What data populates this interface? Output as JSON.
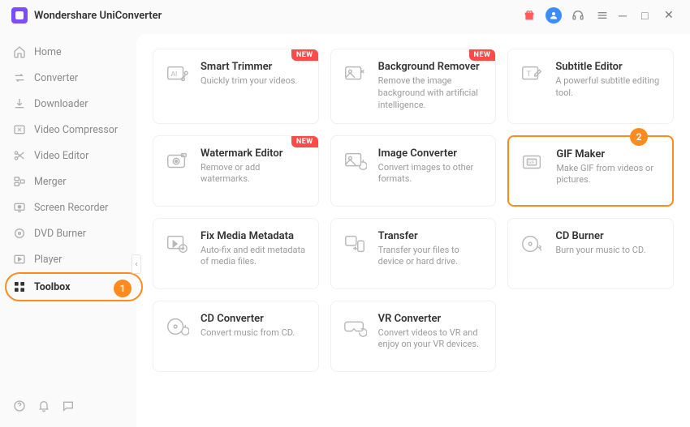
{
  "app": {
    "title": "Wondershare UniConverter"
  },
  "sidebar": {
    "items": [
      {
        "label": "Home"
      },
      {
        "label": "Converter"
      },
      {
        "label": "Downloader"
      },
      {
        "label": "Video Compressor"
      },
      {
        "label": "Video Editor"
      },
      {
        "label": "Merger"
      },
      {
        "label": "Screen Recorder"
      },
      {
        "label": "DVD Burner"
      },
      {
        "label": "Player"
      },
      {
        "label": "Toolbox"
      }
    ]
  },
  "annotations": {
    "one": "1",
    "two": "2"
  },
  "new_label": "NEW",
  "tools": [
    {
      "title": "Smart Trimmer",
      "desc": "Quickly trim your videos.",
      "new": true
    },
    {
      "title": "Background Remover",
      "desc": "Remove the image background with artificial intelligence.",
      "new": true
    },
    {
      "title": "Subtitle Editor",
      "desc": "A powerful subtitle editing tool."
    },
    {
      "title": "Watermark Editor",
      "desc": "Remove or add watermarks.",
      "new": true
    },
    {
      "title": "Image Converter",
      "desc": "Convert images to other formats."
    },
    {
      "title": "GIF Maker",
      "desc": "Make GIF from videos or pictures.",
      "highlight": true
    },
    {
      "title": "Fix Media Metadata",
      "desc": "Auto-fix and edit metadata of media files."
    },
    {
      "title": "Transfer",
      "desc": "Transfer your files to device or hard drive."
    },
    {
      "title": "CD Burner",
      "desc": "Burn your music to CD."
    },
    {
      "title": "CD Converter",
      "desc": "Convert music from CD."
    },
    {
      "title": "VR Converter",
      "desc": "Convert videos to VR and enjoy on your VR devices."
    }
  ]
}
